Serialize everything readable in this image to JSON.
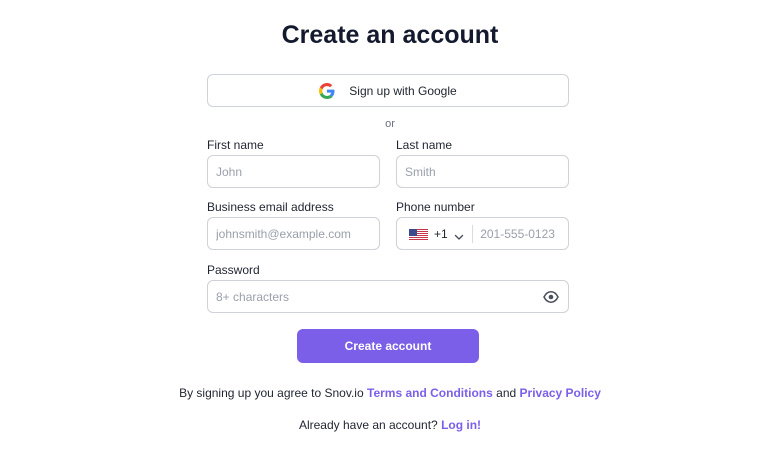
{
  "page": {
    "title": "Create an account"
  },
  "google": {
    "label": "Sign up with Google",
    "icon": "google-icon"
  },
  "separator": "or",
  "form": {
    "first_name": {
      "label": "First name",
      "placeholder": "John",
      "value": ""
    },
    "last_name": {
      "label": "Last name",
      "placeholder": "Smith",
      "value": ""
    },
    "email": {
      "label": "Business email address",
      "placeholder": "johnsmith@example.com",
      "value": ""
    },
    "phone": {
      "label": "Phone number",
      "country_icon": "us-flag-icon",
      "dial_code": "+1",
      "placeholder": "201-555-0123",
      "value": ""
    },
    "password": {
      "label": "Password",
      "placeholder": "8+ characters",
      "value": "",
      "toggle_icon": "eye-icon"
    }
  },
  "submit": {
    "label": "Create account"
  },
  "legal": {
    "prefix": "By signing up you agree to Snov.io",
    "terms_link": "Terms and Conditions",
    "middle": "and",
    "privacy_link": "Privacy Policy"
  },
  "login": {
    "prompt": "Already have an account?",
    "link": "Log in!"
  },
  "colors": {
    "accent": "#7b5fe8",
    "border": "#cfd2d8",
    "title": "#141a2e"
  }
}
